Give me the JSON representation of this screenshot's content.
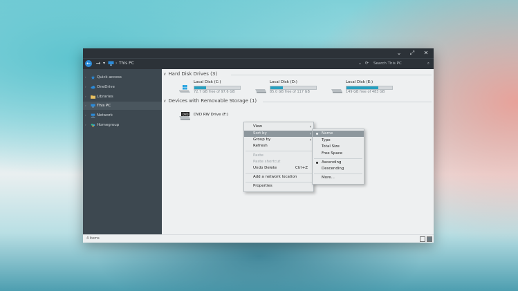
{
  "window": {
    "controls": {
      "minimize": "⌄",
      "maximize": "⤢",
      "close": "✕"
    }
  },
  "toolbar": {
    "back_icon": "←",
    "forward_icon": "→",
    "up_icon": "▾",
    "breadcrumb_separator": "›",
    "breadcrumb": "This PC",
    "refresh_icon": "⟳",
    "dropdown_icon": "⌄",
    "search_placeholder": "Search This PC",
    "search_icon": "⌕"
  },
  "sidebar": {
    "items": [
      {
        "label": "Quick access",
        "icon": "star-icon",
        "color": "#2b8ad8"
      },
      {
        "label": "OneDrive",
        "icon": "cloud-icon",
        "color": "#2b8ad8"
      },
      {
        "label": "Libraries",
        "icon": "folder-icon",
        "color": "#e2b34a"
      },
      {
        "label": "This PC",
        "icon": "computer-icon",
        "color": "#2b8ad8",
        "selected": true
      },
      {
        "label": "Network",
        "icon": "network-icon",
        "color": "#2b8ad8"
      },
      {
        "label": "Homegroup",
        "icon": "homegroup-icon",
        "color": "#2fb58a"
      }
    ]
  },
  "groups": {
    "hard_disks": {
      "title": "Hard Disk Drives (3)",
      "chevron": "∨"
    },
    "removable": {
      "title": "Devices with Removable Storage (1)",
      "chevron": "∨"
    }
  },
  "drives": [
    {
      "name": "Local Disk (C:)",
      "free": "72.7 GB free of 97.6 GB",
      "used_fraction": 0.26,
      "icon": "windows-drive-icon"
    },
    {
      "name": "Local Disk (D:)",
      "free": "85.0 GB free of 117 GB",
      "used_fraction": 0.27,
      "icon": "drive-icon"
    },
    {
      "name": "Local Disk (E:)",
      "free": "149 GB free of 483 GB",
      "used_fraction": 0.69,
      "icon": "drive-icon"
    }
  ],
  "dvd": {
    "name": "DVD RW Drive (F:)",
    "icon_label": "DVD"
  },
  "context_menu": {
    "view": "View",
    "sort_by": "Sort by",
    "group_by": "Group by",
    "refresh": "Refresh",
    "paste": "Paste",
    "paste_shortcut": "Paste shortcut",
    "undo_delete": "Undo Delete",
    "undo_shortcut": "Ctrl+Z",
    "add_network": "Add a network location",
    "properties": "Properties",
    "submenu_arrow": "›"
  },
  "sort_menu": {
    "name": "Name",
    "type": "Type",
    "total_size": "Total Size",
    "free_space": "Free Space",
    "ascending": "Ascending",
    "descending": "Descending",
    "more": "More..."
  },
  "status": {
    "items": "4 items"
  },
  "colors": {
    "accent": "#26a0c0",
    "titlebar": "#2c3238",
    "sidebar": "#3d4850",
    "selected": "#4a565e"
  }
}
